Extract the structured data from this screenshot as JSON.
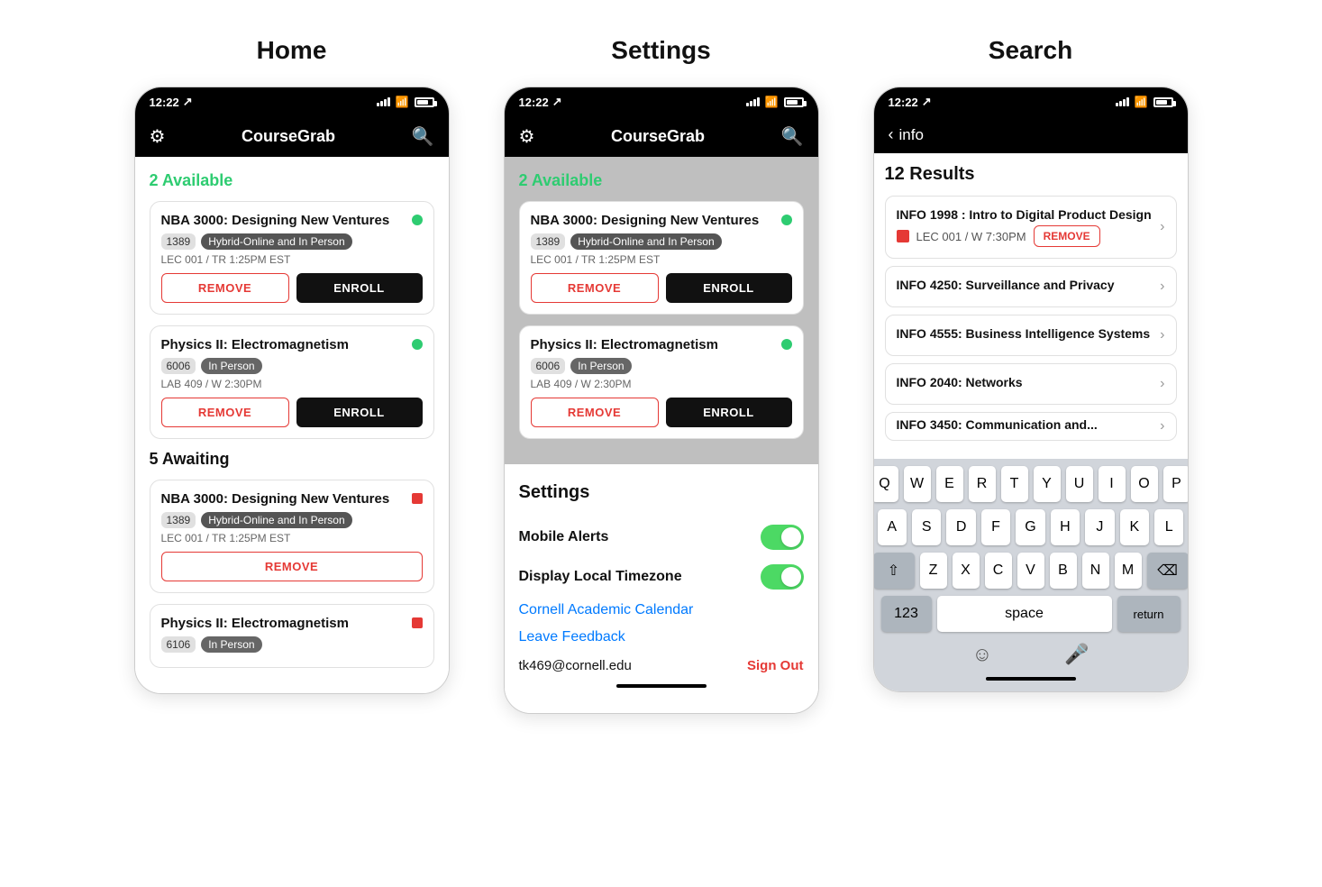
{
  "titles": {
    "home": "Home",
    "settings": "Settings",
    "search": "Search"
  },
  "app_name": "CourseGrab",
  "status_bar": {
    "time": "12:22",
    "arrow": "↗"
  },
  "home": {
    "available_header": "2 Available",
    "awaiting_header": "5 Awaiting",
    "available_courses": [
      {
        "name": "NBA 3000: Designing New Ventures",
        "number": "1389",
        "tag": "Hybrid-Online and In Person",
        "details": "LEC 001 / TR 1:25PM EST",
        "status": "green"
      },
      {
        "name": "Physics II: Electromagnetism",
        "number": "6006",
        "tag": "In Person",
        "details": "LAB 409 / W 2:30PM",
        "status": "green"
      }
    ],
    "awaiting_courses": [
      {
        "name": "NBA 3000: Designing New Ventures",
        "number": "1389",
        "tag": "Hybrid-Online and In Person",
        "details": "LEC 001 / TR 1:25PM EST",
        "status": "red"
      },
      {
        "name": "Physics II: Electromagnetism",
        "number": "6106",
        "tag": "In Person",
        "details": "",
        "status": "red"
      }
    ]
  },
  "settings_modal": {
    "title": "Settings",
    "mobile_alerts_label": "Mobile Alerts",
    "mobile_alerts_on": true,
    "display_timezone_label": "Display Local Timezone",
    "display_timezone_on": true,
    "calendar_link": "Cornell Academic Calendar",
    "feedback_link": "Leave Feedback",
    "email": "tk469@cornell.edu",
    "sign_out": "Sign Out"
  },
  "search": {
    "back_label": "info",
    "results_header": "12 Results",
    "search_value": "info",
    "results": [
      {
        "name": "INFO 1998 : Intro to Digital Product Design",
        "section": "LEC 001 / W 7:30PM",
        "has_remove": true,
        "has_red_sq": true
      },
      {
        "name": "INFO 4250: Surveillance and Privacy",
        "section": "",
        "has_remove": false,
        "has_red_sq": false
      },
      {
        "name": "INFO 4555: Business Intelligence Systems",
        "section": "",
        "has_remove": false,
        "has_red_sq": false
      },
      {
        "name": "INFO 2040: Networks",
        "section": "",
        "has_remove": false,
        "has_red_sq": false
      },
      {
        "name": "INFO 3450: Communication and...",
        "section": "",
        "has_remove": false,
        "has_red_sq": false
      }
    ]
  },
  "keyboard": {
    "rows": [
      [
        "Q",
        "W",
        "E",
        "R",
        "T",
        "Y",
        "U",
        "I",
        "O",
        "P"
      ],
      [
        "A",
        "S",
        "D",
        "F",
        "G",
        "H",
        "J",
        "K",
        "L"
      ],
      [
        "Z",
        "X",
        "C",
        "V",
        "B",
        "N",
        "M"
      ]
    ],
    "num_key": "123",
    "space_key": "space",
    "return_key": "return",
    "delete_symbol": "⌫",
    "shift_symbol": "⇧"
  },
  "buttons": {
    "remove": "REMOVE",
    "enroll": "ENROLL",
    "remove_label": "REMOVE"
  }
}
